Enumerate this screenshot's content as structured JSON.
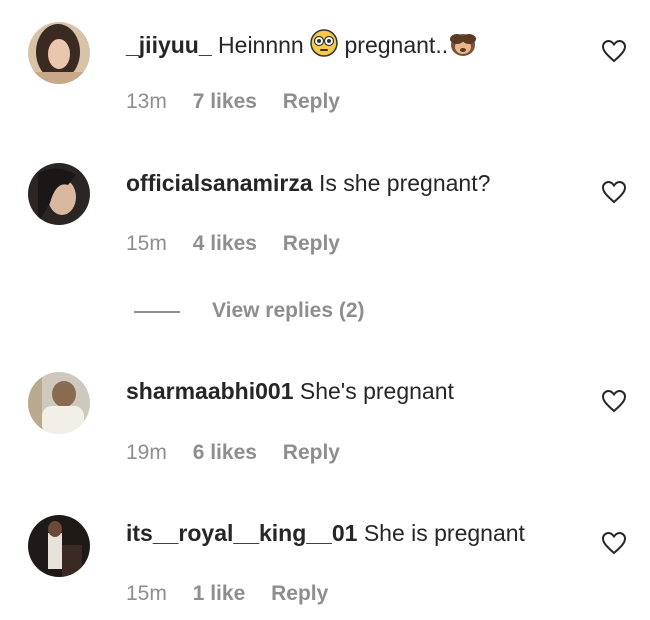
{
  "comments": [
    {
      "username": "_jiiyuu_",
      "text_before": "Heinnnn",
      "text_after": "pregnant..",
      "time": "13m",
      "likes": "7 likes",
      "reply": "Reply",
      "avatar_icon": "avatar-photo",
      "emoji_icons": [
        "flushed-face-emoji",
        "see-no-evil-monkey-emoji"
      ]
    },
    {
      "username": "officialsanamirza",
      "text": "Is she pregnant?",
      "time": "15m",
      "likes": "4 likes",
      "reply": "Reply",
      "avatar_icon": "avatar-photo"
    },
    {
      "username": "sharmaabhi001",
      "text": "She's pregnant",
      "time": "19m",
      "likes": "6 likes",
      "reply": "Reply",
      "avatar_icon": "avatar-photo"
    },
    {
      "username": "its__royal__king__01",
      "text": "She is pregnant",
      "time": "15m",
      "likes": "1 like",
      "reply": "Reply",
      "avatar_icon": "avatar-photo"
    }
  ],
  "view_replies": {
    "label": "View replies (2)"
  },
  "icons": {
    "like": "heart-outline-icon"
  },
  "colors": {
    "text": "#262626",
    "meta": "#8e8e8e"
  }
}
